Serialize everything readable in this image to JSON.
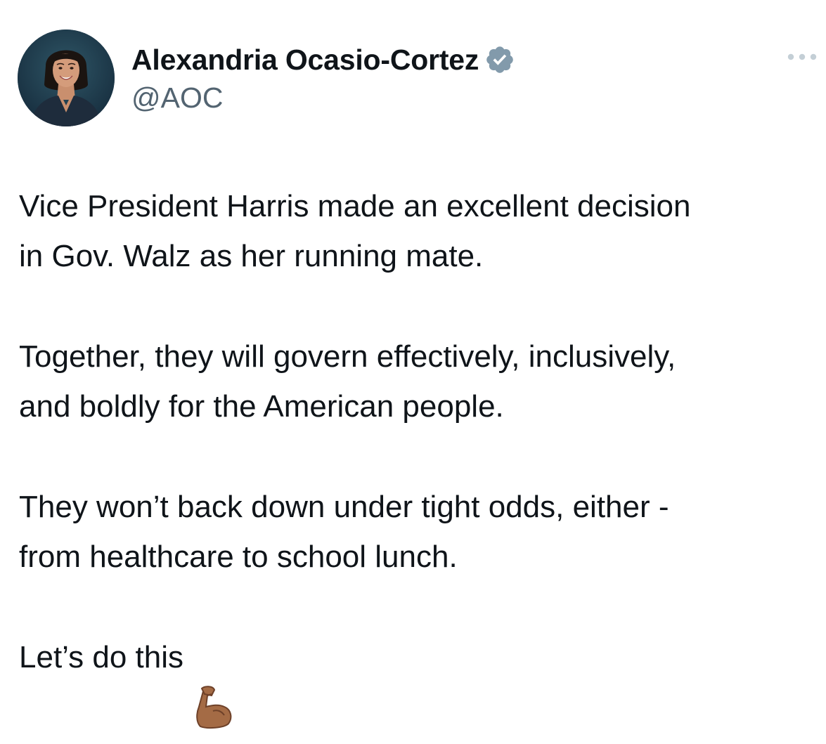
{
  "author": {
    "display_name": "Alexandria Ocasio-Cortez",
    "handle": "@AOC",
    "verified": true,
    "avatar_icon": "profile-photo",
    "verified_icon": "verified-badge-icon",
    "verified_color": "#829aab"
  },
  "menu": {
    "icon": "more-options-icon"
  },
  "tweet": {
    "paragraphs": [
      "Vice President Harris made an excellent decision\nin Gov. Walz as her running mate.",
      "Together, they will govern effectively, inclusively,\nand boldly for the American people.",
      "They won’t back down under tight odds, either -\nfrom healthcare to school lunch.",
      "Let’s do this"
    ],
    "emoji": "flexed-biceps-medium-dark-skin"
  },
  "colors": {
    "text_primary": "#0f1419",
    "text_secondary": "#536471",
    "background": "#ffffff"
  }
}
